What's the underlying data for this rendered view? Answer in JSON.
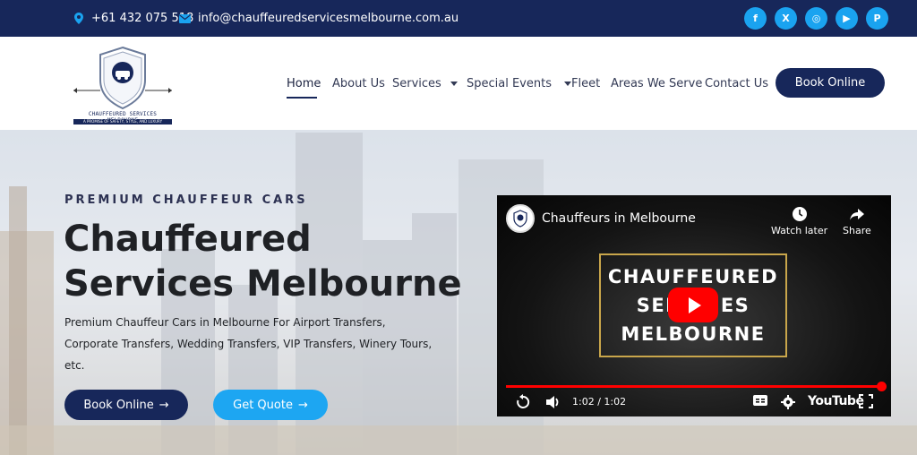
{
  "topbar": {
    "phone": "+61 432 075 518",
    "email": "info@chauffeuredservicesmelbourne.com.au",
    "socials": [
      "f",
      "X",
      "◎",
      "▶",
      "P"
    ],
    "social_names": [
      "facebook-icon",
      "x-icon",
      "instagram-icon",
      "youtube-icon",
      "pinterest-icon"
    ],
    "colors": {
      "bar": "#17275a",
      "social": "#1aa3f0"
    }
  },
  "logo": {
    "caption": "CHAUFFEURED SERVICES MELBOURNE",
    "tagline": "A PROMISE OF SAFETY, STYLE, AND LUXURY"
  },
  "nav": {
    "items": [
      "Home",
      "About Us",
      "Services",
      "Special Events",
      "Fleet",
      "Areas We Serve",
      "Contact Us"
    ],
    "book_label": "Book Online"
  },
  "hero": {
    "eyebrow": "PREMIUM CHAUFFEUR CARS",
    "headline_line1": "Chauffeured",
    "headline_line2": "Services Melbourne",
    "desc_line1": "Premium Chauffeur Cars in Melbourne For Airport Transfers,",
    "desc_line2": "Corporate Transfers, Wedding Transfers, VIP Transfers, Winery Tours,",
    "desc_line3": "etc.",
    "btn_book": "Book Online",
    "btn_quote": "Get Quote"
  },
  "video": {
    "title": "Chauffeurs in Melbourne",
    "watch_later": "Watch later",
    "share": "Share",
    "line1": "CHAUFFEURED",
    "line2": "SERVICES",
    "line3": "MELBOURNE",
    "time": "1:02 / 1:02",
    "youtube": "YouTube",
    "progress": 1.0
  }
}
